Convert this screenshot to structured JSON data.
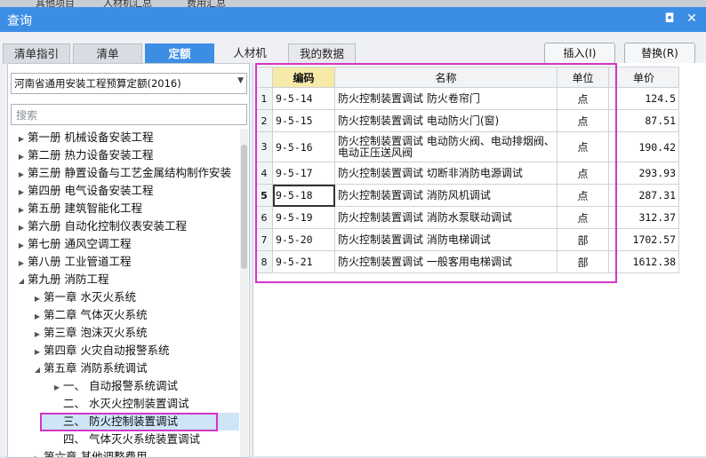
{
  "top_tabs": [
    "其他项目",
    "人材机汇总",
    "费用汇总"
  ],
  "window": {
    "title": "查询",
    "restore_glyph": "◘",
    "close_glyph": "✕"
  },
  "tabs": [
    {
      "label": "清单指引"
    },
    {
      "label": "清单"
    },
    {
      "label": "定额",
      "active": true
    },
    {
      "label": "人材机"
    },
    {
      "label": "我的数据"
    }
  ],
  "buttons": {
    "insert": "插入(I)",
    "replace": "替换(R)"
  },
  "left": {
    "quota_select": "河南省通用安装工程预算定额(2016)",
    "search_placeholder": "搜索",
    "tree": [
      {
        "label": "第一册  机械设备安装工程",
        "level": 0,
        "expander": "▶"
      },
      {
        "label": "第二册  热力设备安装工程",
        "level": 0,
        "expander": "▶"
      },
      {
        "label": "第三册  静置设备与工艺金属结构制作安装",
        "level": 0,
        "expander": "▶"
      },
      {
        "label": "第四册  电气设备安装工程",
        "level": 0,
        "expander": "▶"
      },
      {
        "label": "第五册  建筑智能化工程",
        "level": 0,
        "expander": "▶"
      },
      {
        "label": "第六册  自动化控制仪表安装工程",
        "level": 0,
        "expander": "▶"
      },
      {
        "label": "第七册  通风空调工程",
        "level": 0,
        "expander": "▶"
      },
      {
        "label": "第八册  工业管道工程",
        "level": 0,
        "expander": "▶"
      },
      {
        "label": "第九册  消防工程",
        "level": 0,
        "expander": "◢"
      },
      {
        "label": "第一章  水灭火系统",
        "level": 1,
        "expander": "▶"
      },
      {
        "label": "第二章  气体灭火系统",
        "level": 1,
        "expander": "▶"
      },
      {
        "label": "第三章  泡沫灭火系统",
        "level": 1,
        "expander": "▶"
      },
      {
        "label": "第四章  火灾自动报警系统",
        "level": 1,
        "expander": "▶"
      },
      {
        "label": "第五章  消防系统调试",
        "level": 1,
        "expander": "◢"
      },
      {
        "label": "一、  自动报警系统调试",
        "level": 2,
        "expander": "▶"
      },
      {
        "label": "二、  水灭火控制装置调试",
        "level": 2,
        "expander": ""
      },
      {
        "label": "三、  防火控制装置调试",
        "level": 2,
        "expander": "",
        "selected": true
      },
      {
        "label": "四、  气体灭火系统装置调试",
        "level": 2,
        "expander": ""
      },
      {
        "label": "第六章  其他调整费用",
        "level": 1,
        "expander": "▶"
      }
    ]
  },
  "grid": {
    "headers": {
      "code": "编码",
      "name": "名称",
      "unit": "单位",
      "price": "单价"
    },
    "rows": [
      {
        "no": "1",
        "code": "9-5-14",
        "name": "防火控制装置调试  防火卷帘门",
        "unit": "点",
        "price": "124.5"
      },
      {
        "no": "2",
        "code": "9-5-15",
        "name": "防火控制装置调试  电动防火门(窗)",
        "unit": "点",
        "price": "87.51"
      },
      {
        "no": "3",
        "code": "9-5-16",
        "name": "防火控制装置调试  电动防火阀、电动排烟阀、电动正压送风阀",
        "unit": "点",
        "price": "190.42"
      },
      {
        "no": "4",
        "code": "9-5-17",
        "name": "防火控制装置调试  切断非消防电源调试",
        "unit": "点",
        "price": "293.93"
      },
      {
        "no": "5",
        "code": "9-5-18",
        "name": "防火控制装置调试  消防风机调试",
        "unit": "点",
        "price": "287.31",
        "current": true
      },
      {
        "no": "6",
        "code": "9-5-19",
        "name": "防火控制装置调试  消防水泵联动调试",
        "unit": "点",
        "price": "312.37"
      },
      {
        "no": "7",
        "code": "9-5-20",
        "name": "防火控制装置调试  消防电梯调试",
        "unit": "部",
        "price": "1702.57"
      },
      {
        "no": "8",
        "code": "9-5-21",
        "name": "防火控制装置调试  一般客用电梯调试",
        "unit": "部",
        "price": "1612.38"
      }
    ]
  },
  "colors": {
    "title_bar": "#3c8ee5",
    "active_tab": "#3c8ee5",
    "highlight_box": "#d335c8",
    "selected_row": "#cde5f7",
    "code_header": "#f7e9a8"
  }
}
